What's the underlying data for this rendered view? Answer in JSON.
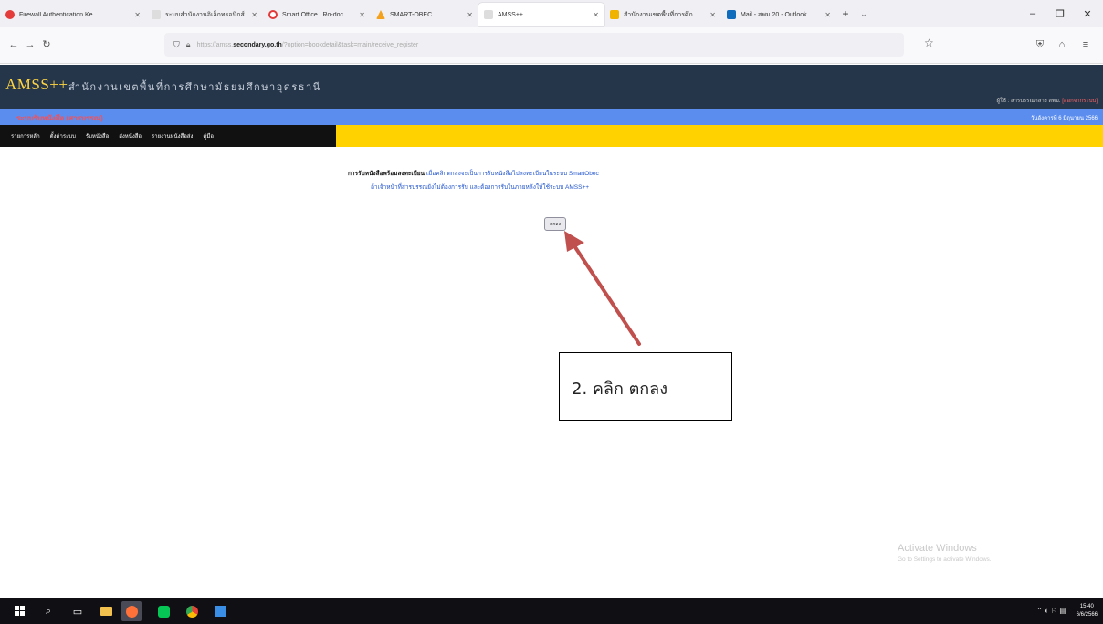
{
  "browser": {
    "tabs": [
      {
        "label": "Firewall Authentication Ke...",
        "icon": "firewall-icon",
        "color": "#e43b3b",
        "active": false
      },
      {
        "label": "ระบบสำนักงานอิเล็กทรอนิกส์",
        "icon": "page-icon",
        "color": "#bbbbbb",
        "active": false
      },
      {
        "label": "Smart Office | Ro-doc...",
        "icon": "smart-office-icon",
        "color": "#e23a3a",
        "active": false
      },
      {
        "label": "SMART-OBEC",
        "icon": "smart-obec-icon",
        "color": "#f4a11d",
        "active": false
      },
      {
        "label": "AMSS++",
        "icon": "page-icon",
        "color": "#bbbbbb",
        "active": true
      },
      {
        "label": "สำนักงานเขตพื้นที่การศึก...",
        "icon": "grid-app-icon",
        "color": "#f0b400",
        "active": false
      },
      {
        "label": "Mail - สพม.20 - Outlook",
        "icon": "outlook-icon",
        "color": "#0f6cbd",
        "active": false
      }
    ],
    "url": {
      "prefix": "https://amss.",
      "domain": "secondary.go.th",
      "path": "/?option=bookdetail&task=main/receive_register"
    }
  },
  "site": {
    "logo": "AMSS++",
    "org_name": "สำนักงานเขตพื้นที่การศึกษามัธยมศึกษาอุดรธานี",
    "user_label": "ผู้ใช้ : สารบรรณกลาง สพม.",
    "user_name": "[ออกจากระบบ]",
    "system_title": "ระบบรับหนังสือ (สารบรรณ)",
    "date": "วันอังคารที่ 6 มิถุนายน 2566",
    "menu": [
      "รายการหลัก",
      "ตั้งค่าระบบ",
      "รับหนังสือ",
      "ส่งหนังสือ",
      "รายงานหนังสือส่ง",
      "คู่มือ"
    ]
  },
  "content": {
    "line1_bold": "การรับหนังสือพร้อมลงทะเบียน",
    "line1_blue": "เมื่อคลิกตกลงจะเป็นการรับหนังสือไปลงทะเบียนในระบบ SmartObec",
    "line2": "ถ้าเจ้าหน้าที่สารบรรณยังไม่ต้องการรับ และต้องการรับในภายหลังให้ใช้ระบบ AMSS++",
    "ok_label": "ตกลง",
    "callout": "2. คลิก ตกลง",
    "arrow_color": "#c0504d"
  },
  "watermark": {
    "title": "Activate Windows",
    "subtitle": "Go to Settings to activate Windows."
  },
  "taskbar": {
    "time": "15:40",
    "date": "6/6/2566"
  }
}
